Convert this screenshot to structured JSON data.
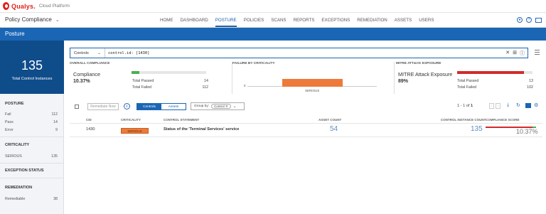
{
  "app": {
    "brand": "Qualys.",
    "platform": "Cloud Platform",
    "module": "Policy Compliance"
  },
  "nav": [
    "HOME",
    "DASHBOARD",
    "POSTURE",
    "POLICIES",
    "SCANS",
    "REPORTS",
    "EXCEPTIONS",
    "REMEDIATION",
    "ASSETS",
    "USERS"
  ],
  "nav_active": "POSTURE",
  "page_title": "Posture",
  "sidebar": {
    "total_value": "135",
    "total_label": "Total Control Instances",
    "posture": {
      "title": "POSTURE",
      "rows": [
        {
          "label": "Fail",
          "value": "112"
        },
        {
          "label": "Pass",
          "value": "14"
        },
        {
          "label": "Error",
          "value": "9"
        }
      ]
    },
    "criticality": {
      "title": "CRITICALITY",
      "rows": [
        {
          "label": "SERIOUS",
          "value": "135"
        }
      ]
    },
    "exception": {
      "title": "EXCEPTION STATUS"
    },
    "remediation": {
      "title": "REMEDIATION",
      "rows": [
        {
          "label": "Remediable",
          "value": "38"
        }
      ]
    }
  },
  "search": {
    "scope": "Controls",
    "query": "control.id: [1430]"
  },
  "overall": {
    "title": "OVERALL COMPLIANCE",
    "name": "Compliance",
    "percent": "10.37%",
    "fill": 0.1037,
    "passed_label": "Total Passed",
    "passed": "14",
    "failed_label": "Total Failed",
    "failed": "112"
  },
  "failure": {
    "title": "FAILURE BY CRITICALITY",
    "axis_zero": "0",
    "bar_label": "SERIOUS"
  },
  "mitre": {
    "title": "MITRE ATT&CK EXPOSURE",
    "name": "MITRE Attack Exposure",
    "percent": "89%",
    "fill": 0.89,
    "passed_label": "Total Passed",
    "passed": "13",
    "failed_label": "Total Failed",
    "failed": "102"
  },
  "toolbar": {
    "remediate_label": "Remediate Now",
    "info": "i",
    "tab_controls": "Controls",
    "tab_assets": "Assets",
    "group_by_label": "Group by:",
    "group_by_value": "Control",
    "pager_prefix": "1 - 1 of",
    "pager_total": "1"
  },
  "table": {
    "headers": {
      "cid": "CID",
      "criticality": "CRITICALITY",
      "statement": "CONTROL STATEMENT",
      "asset_count": "ASSET COUNT",
      "instance_count": "CONTROL INSTANCE COUNT",
      "score": "COMPLIANCE SCORE"
    },
    "rows": [
      {
        "cid": "1430",
        "criticality": "SERIOUS",
        "statement": "Status of the 'Terminal Services' service",
        "asset_count": "54",
        "instance_count": "135",
        "score": "10.37%"
      }
    ]
  },
  "colors": {
    "accent": "#1a66b5",
    "sidebar_total": "#0f4c8a",
    "serious": "#ec7b3b",
    "fail": "#d32a2a",
    "pass": "#4caf50"
  },
  "icons": [
    "user-icon",
    "help-icon",
    "mail-icon",
    "close-icon",
    "add-icon",
    "help-icon",
    "menu-icon",
    "download-icon",
    "refresh-icon",
    "chart-icon",
    "settings-icon"
  ]
}
